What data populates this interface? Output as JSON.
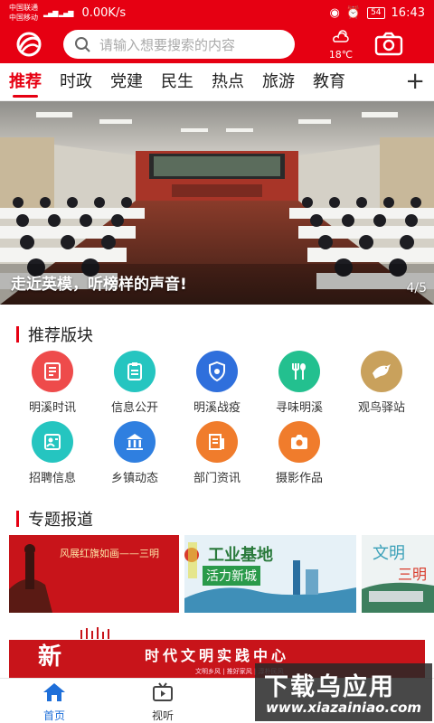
{
  "status_bar": {
    "carrier1": "中国联通",
    "carrier2": "中国移动",
    "hd": "HD",
    "net1": "4G",
    "net2": "4G",
    "speed": "0.00K/s",
    "battery": "54",
    "time": "16:43"
  },
  "header": {
    "search_placeholder": "请输入想要搜索的内容",
    "temperature": "18℃",
    "accent_color": "#e60012"
  },
  "tabs": [
    "推荐",
    "时政",
    "党建",
    "民生",
    "热点",
    "旅游",
    "教育"
  ],
  "tab_add": "+",
  "banner": {
    "caption": "走近英模，听榜样的声音!",
    "page": "4/5"
  },
  "recommend_section": {
    "title": "推荐版块",
    "items": [
      {
        "label": "明溪时讯",
        "icon": "news-icon",
        "color": "#ee4b4b"
      },
      {
        "label": "信息公开",
        "icon": "document-icon",
        "color": "#25c5c0"
      },
      {
        "label": "明溪战疫",
        "icon": "shield-virus-icon",
        "color": "#2f6fdc"
      },
      {
        "label": "寻味明溪",
        "icon": "fork-spoon-icon",
        "color": "#23c08f"
      },
      {
        "label": "观鸟驿站",
        "icon": "bird-icon",
        "color": "#c9a15c"
      },
      {
        "label": "招聘信息",
        "icon": "recruit-icon",
        "color": "#25c5c0"
      },
      {
        "label": "乡镇动态",
        "icon": "building-icon",
        "color": "#2f7fe0"
      },
      {
        "label": "部门资讯",
        "icon": "department-icon",
        "color": "#f07c2c"
      },
      {
        "label": "摄影作品",
        "icon": "camera-icon",
        "color": "#f07c2c"
      }
    ]
  },
  "topics_section": {
    "title": "专题报道",
    "items": [
      {
        "text": "风展红旗如画——三明"
      },
      {
        "text": "工业基地",
        "text2": "活力新城"
      },
      {
        "text": "文明",
        "text2": "三明"
      }
    ]
  },
  "big_banner": {
    "char": "新",
    "title": "时代文明实践中心",
    "subtitle": "文明乡风 | 推好家风 | 淳朴民风"
  },
  "bottom_nav": [
    {
      "label": "首页",
      "icon": "home-icon",
      "active": true
    },
    {
      "label": "视听",
      "icon": "tv-icon",
      "active": false
    }
  ],
  "watermark": {
    "big": "下载乌应用",
    "small": "www.xiazainiao.com"
  }
}
